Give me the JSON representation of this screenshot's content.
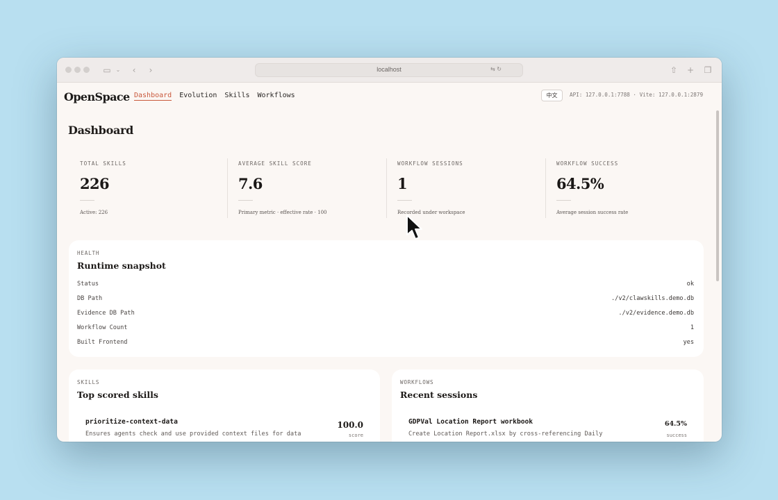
{
  "browser": {
    "url": "localhost"
  },
  "nav": {
    "logo": "OpenSpace",
    "links": [
      "Dashboard",
      "Evolution",
      "Skills",
      "Workflows"
    ],
    "active": "Dashboard",
    "language_button": "中文",
    "api_info": "API: 127.0.0.1:7788 · Vite: 127.0.0.1:2879"
  },
  "page": {
    "title": "Dashboard"
  },
  "metrics": [
    {
      "label": "TOTAL SKILLS",
      "value": "226",
      "sub": "Active: 226"
    },
    {
      "label": "AVERAGE SKILL SCORE",
      "value": "7.6",
      "sub": "Primary metric · effective rate · 100"
    },
    {
      "label": "WORKFLOW SESSIONS",
      "value": "1",
      "sub": "Recorded under workspace"
    },
    {
      "label": "WORKFLOW SUCCESS",
      "value": "64.5%",
      "sub": "Average session success rate"
    }
  ],
  "health": {
    "kicker": "HEALTH",
    "title": "Runtime snapshot",
    "rows": [
      {
        "key": "Status",
        "value": "ok"
      },
      {
        "key": "DB Path",
        "value": "./v2/clawskills.demo.db"
      },
      {
        "key": "Evidence DB Path",
        "value": "./v2/evidence.demo.db"
      },
      {
        "key": "Workflow Count",
        "value": "1"
      },
      {
        "key": "Built Frontend",
        "value": "yes"
      }
    ]
  },
  "skills_card": {
    "kicker": "SKILLS",
    "title": "Top scored skills",
    "item": {
      "name": "prioritize-context-data",
      "desc": "Ensures agents check and use provided context files for data",
      "score": "100.0",
      "unit": "score"
    }
  },
  "workflows_card": {
    "kicker": "WORKFLOWS",
    "title": "Recent sessions",
    "item": {
      "name": "GDPVal Location Report workbook",
      "desc": "Create Location Report.xlsx by cross-referencing Daily",
      "score": "64.5%",
      "unit": "success"
    }
  }
}
